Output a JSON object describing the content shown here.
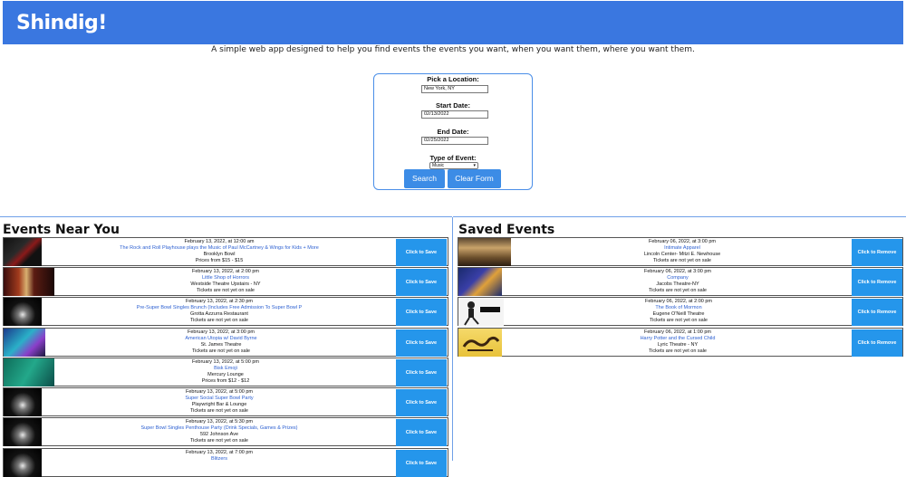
{
  "app": {
    "title": "Shindig!",
    "tagline": "A simple web app designed to help you find events the events you want, when you want them, where you want them."
  },
  "search_form": {
    "location_label": "Pick a Location:",
    "location_value": "New York, NY",
    "start_label": "Start Date:",
    "start_value": "02/13/2022",
    "end_label": "End Date:",
    "end_value": "02/25/2022",
    "type_label": "Type of Event:",
    "type_value": "Music",
    "search_label": "Search",
    "clear_label": "Clear Form"
  },
  "events_near": {
    "heading": "Events Near You",
    "action_label": "Click to Save",
    "items": [
      {
        "date": "February 13, 2022, at 12:00 am",
        "title": "The Rock and Roll Playhouse plays the Music of Paul McCartney & Wings for Kids + More",
        "venue": "Brooklyn Bowl",
        "price": "Prices from $15 - $15"
      },
      {
        "date": "February 13, 2022, at 2:00 pm",
        "title": "Little Shop of Horrors",
        "venue": "Westside Theatre Upstairs - NY",
        "price": "Tickets are not yet on sale"
      },
      {
        "date": "February 13, 2022, at 2:30 pm",
        "title": "Pre-Super Bowl Singles Brunch (Includes Free Admission To Super Bowl P",
        "venue": "Grotta Azzurra Restaurant",
        "price": "Tickets are not yet on sale"
      },
      {
        "date": "February 13, 2022, at 3:00 pm",
        "title": "American Utopia w/ David Byrne",
        "venue": "St. James Theatre",
        "price": "Tickets are not yet on sale"
      },
      {
        "date": "February 13, 2022, at 5:00 pm",
        "title": "Bisk Emoji",
        "venue": "Mercury Lounge",
        "price": "Prices from $12 - $12"
      },
      {
        "date": "February 13, 2022, at 5:00 pm",
        "title": "Super Social Super Bowl Party",
        "venue": "Playwright Bar & Lounge",
        "price": "Tickets are not yet on sale"
      },
      {
        "date": "February 13, 2022, at 5:30 pm",
        "title": "Super Bowl Singles Penthouse Party (Drink Specials, Games & Prizes)",
        "venue": "592 Johnson Ave",
        "price": "Tickets are not yet on sale"
      },
      {
        "date": "February 13, 2022, at 7:00 pm",
        "title": "Blitzers",
        "venue": "",
        "price": ""
      }
    ]
  },
  "saved_events": {
    "heading": "Saved Events",
    "action_label": "Click to Remove",
    "items": [
      {
        "date": "February 06, 2022, at 3:00 pm",
        "title": "Intimate Apparel",
        "venue": "Lincoln Center- Mitzi E. Newhouse",
        "price": "Tickets are not yet on sale"
      },
      {
        "date": "February 06, 2022, at 3:00 pm",
        "title": "Company",
        "venue": "Jacobs Theatre-NY",
        "price": "Tickets are not yet on sale"
      },
      {
        "date": "February 06, 2022, at 2:00 pm",
        "title": "The Book of Mormon",
        "venue": "Eugene O'Neill Theatre",
        "price": "Tickets are not yet on sale"
      },
      {
        "date": "February 06, 2022, at 1:00 pm",
        "title": "Harry Potter and the Cursed Child",
        "venue": "Lyric Theatre - NY",
        "price": "Tickets are not yet on sale"
      }
    ]
  }
}
